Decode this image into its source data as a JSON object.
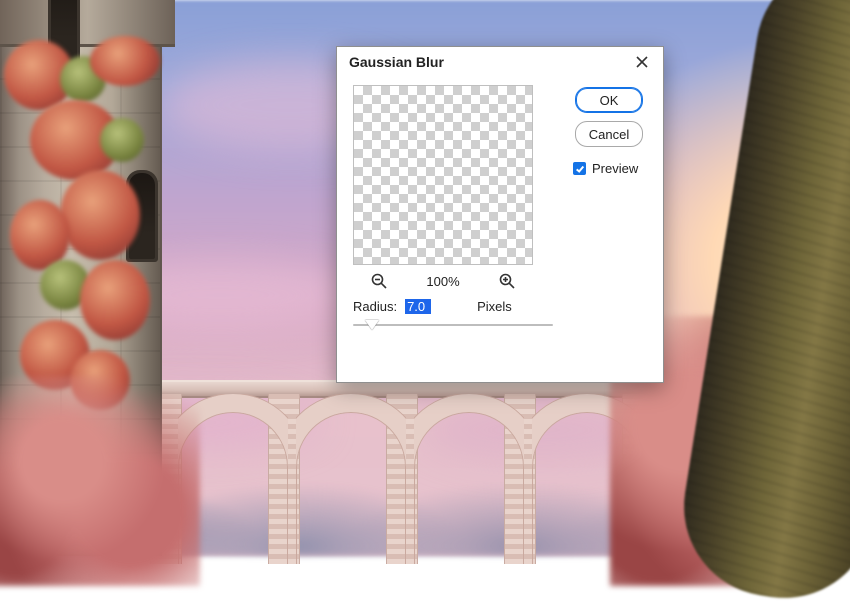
{
  "dialog": {
    "title": "Gaussian Blur",
    "ok_label": "OK",
    "cancel_label": "Cancel",
    "preview_label": "Preview",
    "preview_checked": true,
    "zoom_percent": "100%",
    "radius_label": "Radius:",
    "radius_value": "7.0",
    "radius_unit": "Pixels"
  },
  "icons": {
    "close": "close-icon",
    "zoom_out": "zoom-out-icon",
    "zoom_in": "zoom-in-icon"
  }
}
